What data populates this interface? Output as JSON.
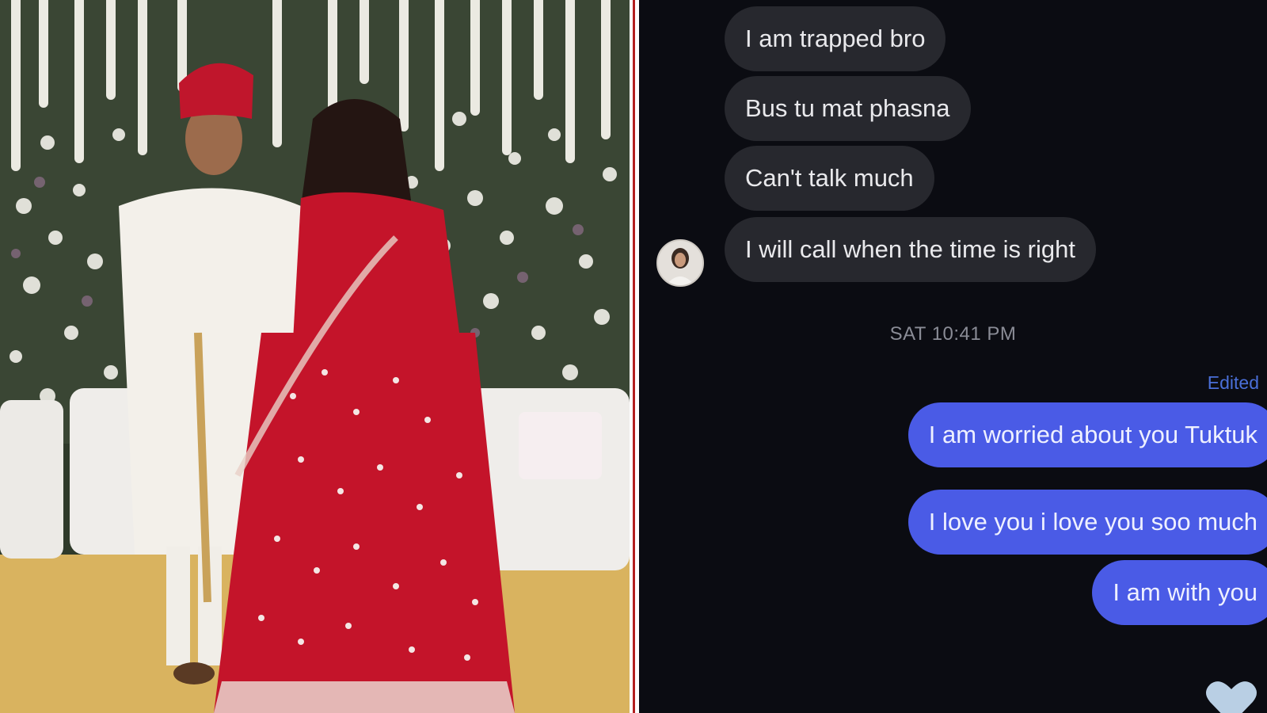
{
  "chat": {
    "incoming": [
      "I am trapped bro",
      "Bus tu mat phasna",
      "Can't talk much",
      "I will call when the time is right"
    ],
    "timestamp": "SAT 10:41 PM",
    "edited_label": "Edited",
    "outgoing": [
      "I am worried about you Tuktuk",
      "I love you i love you soo much",
      "I am with you"
    ],
    "reaction": "heart-icon",
    "colors": {
      "background": "#0b0c12",
      "incoming_bubble": "#27282e",
      "outgoing_bubble": "#4a5be6",
      "edited_text": "#4a6fd8"
    }
  },
  "photo": {
    "subject": "wedding-photo",
    "colors": {
      "lehenga": "#c4142a",
      "sherwani": "#f2efe9",
      "flower_wall": "#3e4a35"
    }
  }
}
